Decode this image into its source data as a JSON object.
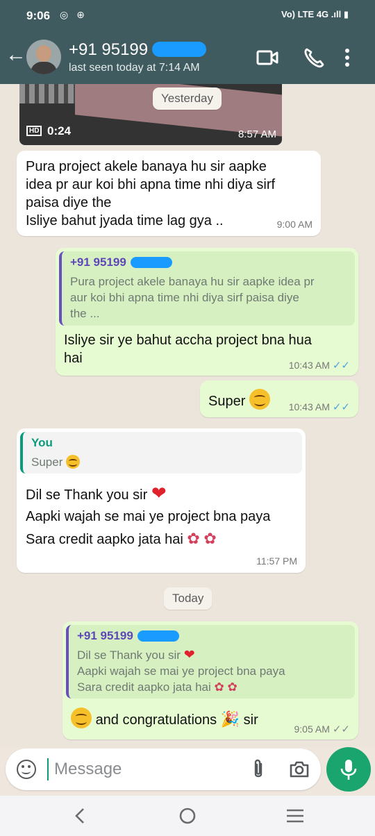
{
  "status_bar": {
    "time": "9:06",
    "left_icons": "◎ ⊕",
    "right_indicators": "Vo) LTE 4G .ıll ▮"
  },
  "header": {
    "contact_name": "+91 95199",
    "last_seen": "last seen today at 7:14 AM"
  },
  "messages": {
    "video": {
      "badge": "HD",
      "duration": "0:24",
      "time": "8:57 AM"
    },
    "date_yesterday": "Yesterday",
    "m1": {
      "lines": [
        "Pura project akele banaya hu sir aapke",
        "idea pr aur koi bhi apna time nhi diya sirf",
        "paisa diye the",
        "Isliye bahut jyada time lag gya .."
      ],
      "time": "9:00 AM"
    },
    "m2": {
      "quote_name": "+91 95199",
      "quote_lines": [
        "Pura project akele banaya hu sir aapke idea pr",
        "aur koi bhi apna time nhi diya sirf paisa diye",
        "the ..."
      ],
      "lines": [
        "Isliye sir ye bahut accha project bna hua",
        "hai"
      ],
      "time": "10:43 AM"
    },
    "m3": {
      "text": "Super",
      "time": "10:43 AM"
    },
    "m4": {
      "quote_name": "You",
      "quote_text": "Super",
      "line1": "Dil se Thank you sir",
      "line2": "Aapki wajah se mai ye project bna paya",
      "line3": "Sara credit aapko jata hai",
      "time": "11:57 PM"
    },
    "date_today": "Today",
    "m5": {
      "quote_name": "+91 95199",
      "quote_line1": "Dil se Thank you sir",
      "quote_line2": "Aapki wajah se mai ye project bna paya",
      "quote_line3": "Sara credit aapko jata hai",
      "text_a": "and congratulations",
      "text_b": "sir",
      "time": "9:05 AM"
    }
  },
  "composer": {
    "placeholder": "Message"
  },
  "icons": {
    "back": "arrow-left",
    "video_call": "video-camera",
    "voice_call": "phone",
    "menu": "more-vertical",
    "emoji": "smiley",
    "attach": "paperclip",
    "camera": "camera",
    "mic": "microphone",
    "nav_back": "chevron-left",
    "nav_home": "circle",
    "nav_recents": "three-lines"
  },
  "colors": {
    "header_bg": "#3f5b60",
    "incoming_bubble": "#ffffff",
    "outgoing_bubble": "#e6fbd1",
    "read_tick": "#4fa3e0",
    "accent_green": "#1aa56e",
    "quote_bar_purple": "#6a4ec0"
  }
}
